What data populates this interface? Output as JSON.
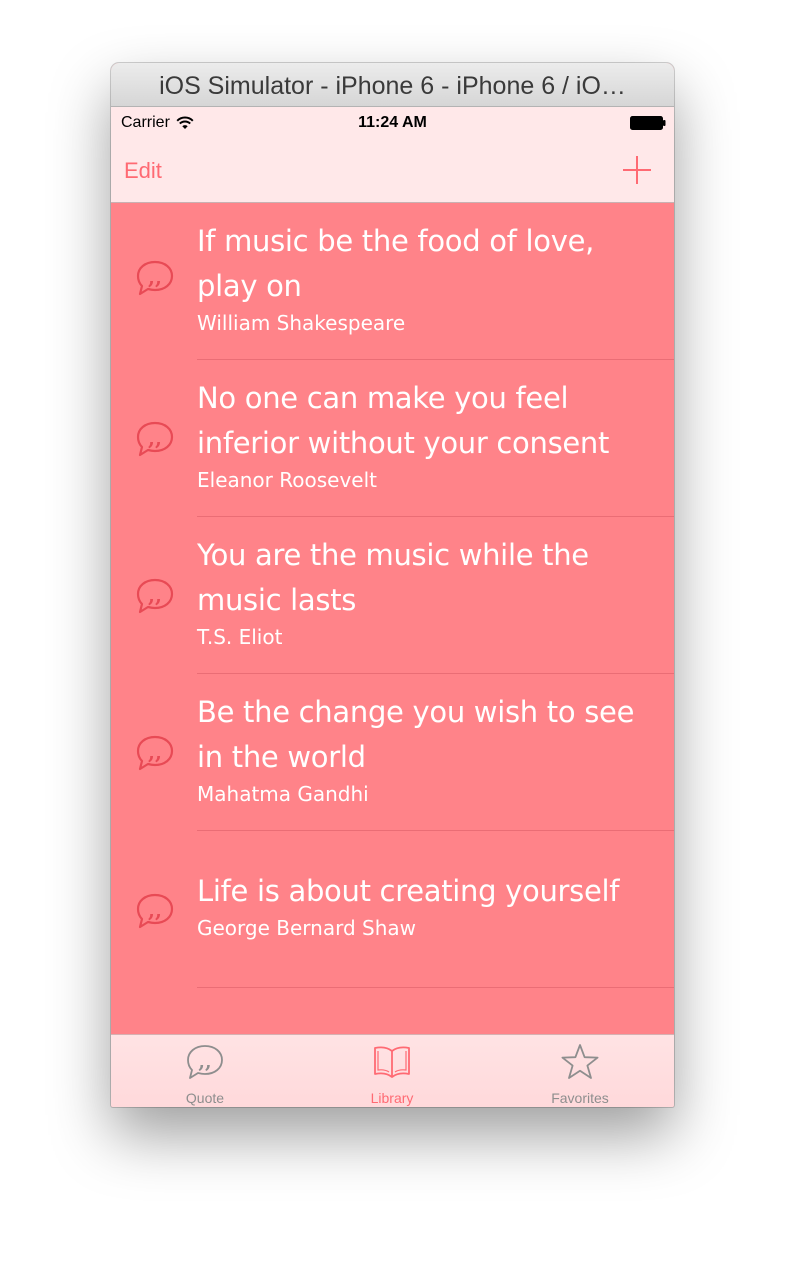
{
  "window": {
    "title": "iOS Simulator - iPhone 6 - iPhone 6 / iO…"
  },
  "statusbar": {
    "carrier": "Carrier",
    "time": "11:24 AM"
  },
  "navbar": {
    "edit_label": "Edit",
    "add_icon": "plus-icon"
  },
  "quotes": [
    {
      "text": "If music be the food of love, play on",
      "author": "William Shakespeare"
    },
    {
      "text": "No one can make you feel inferior without your consent",
      "author": "Eleanor Roosevelt"
    },
    {
      "text": "You are the music while the music lasts",
      "author": "T.S. Eliot"
    },
    {
      "text": "Be the change you wish to see in the world",
      "author": "Mahatma Gandhi"
    },
    {
      "text": "Life is about creating yourself",
      "author": "George Bernard Shaw"
    }
  ],
  "tabbar": {
    "tabs": [
      {
        "label": "Quote",
        "icon": "quote-bubble-icon",
        "selected": false
      },
      {
        "label": "Library",
        "icon": "book-icon",
        "selected": true
      },
      {
        "label": "Favorites",
        "icon": "star-icon",
        "selected": false
      }
    ]
  },
  "colors": {
    "accent": "#ff6a73",
    "list_background": "#ff8389",
    "bar_background": "#ffe8e9",
    "tab_inactive": "#8e8e8e"
  }
}
